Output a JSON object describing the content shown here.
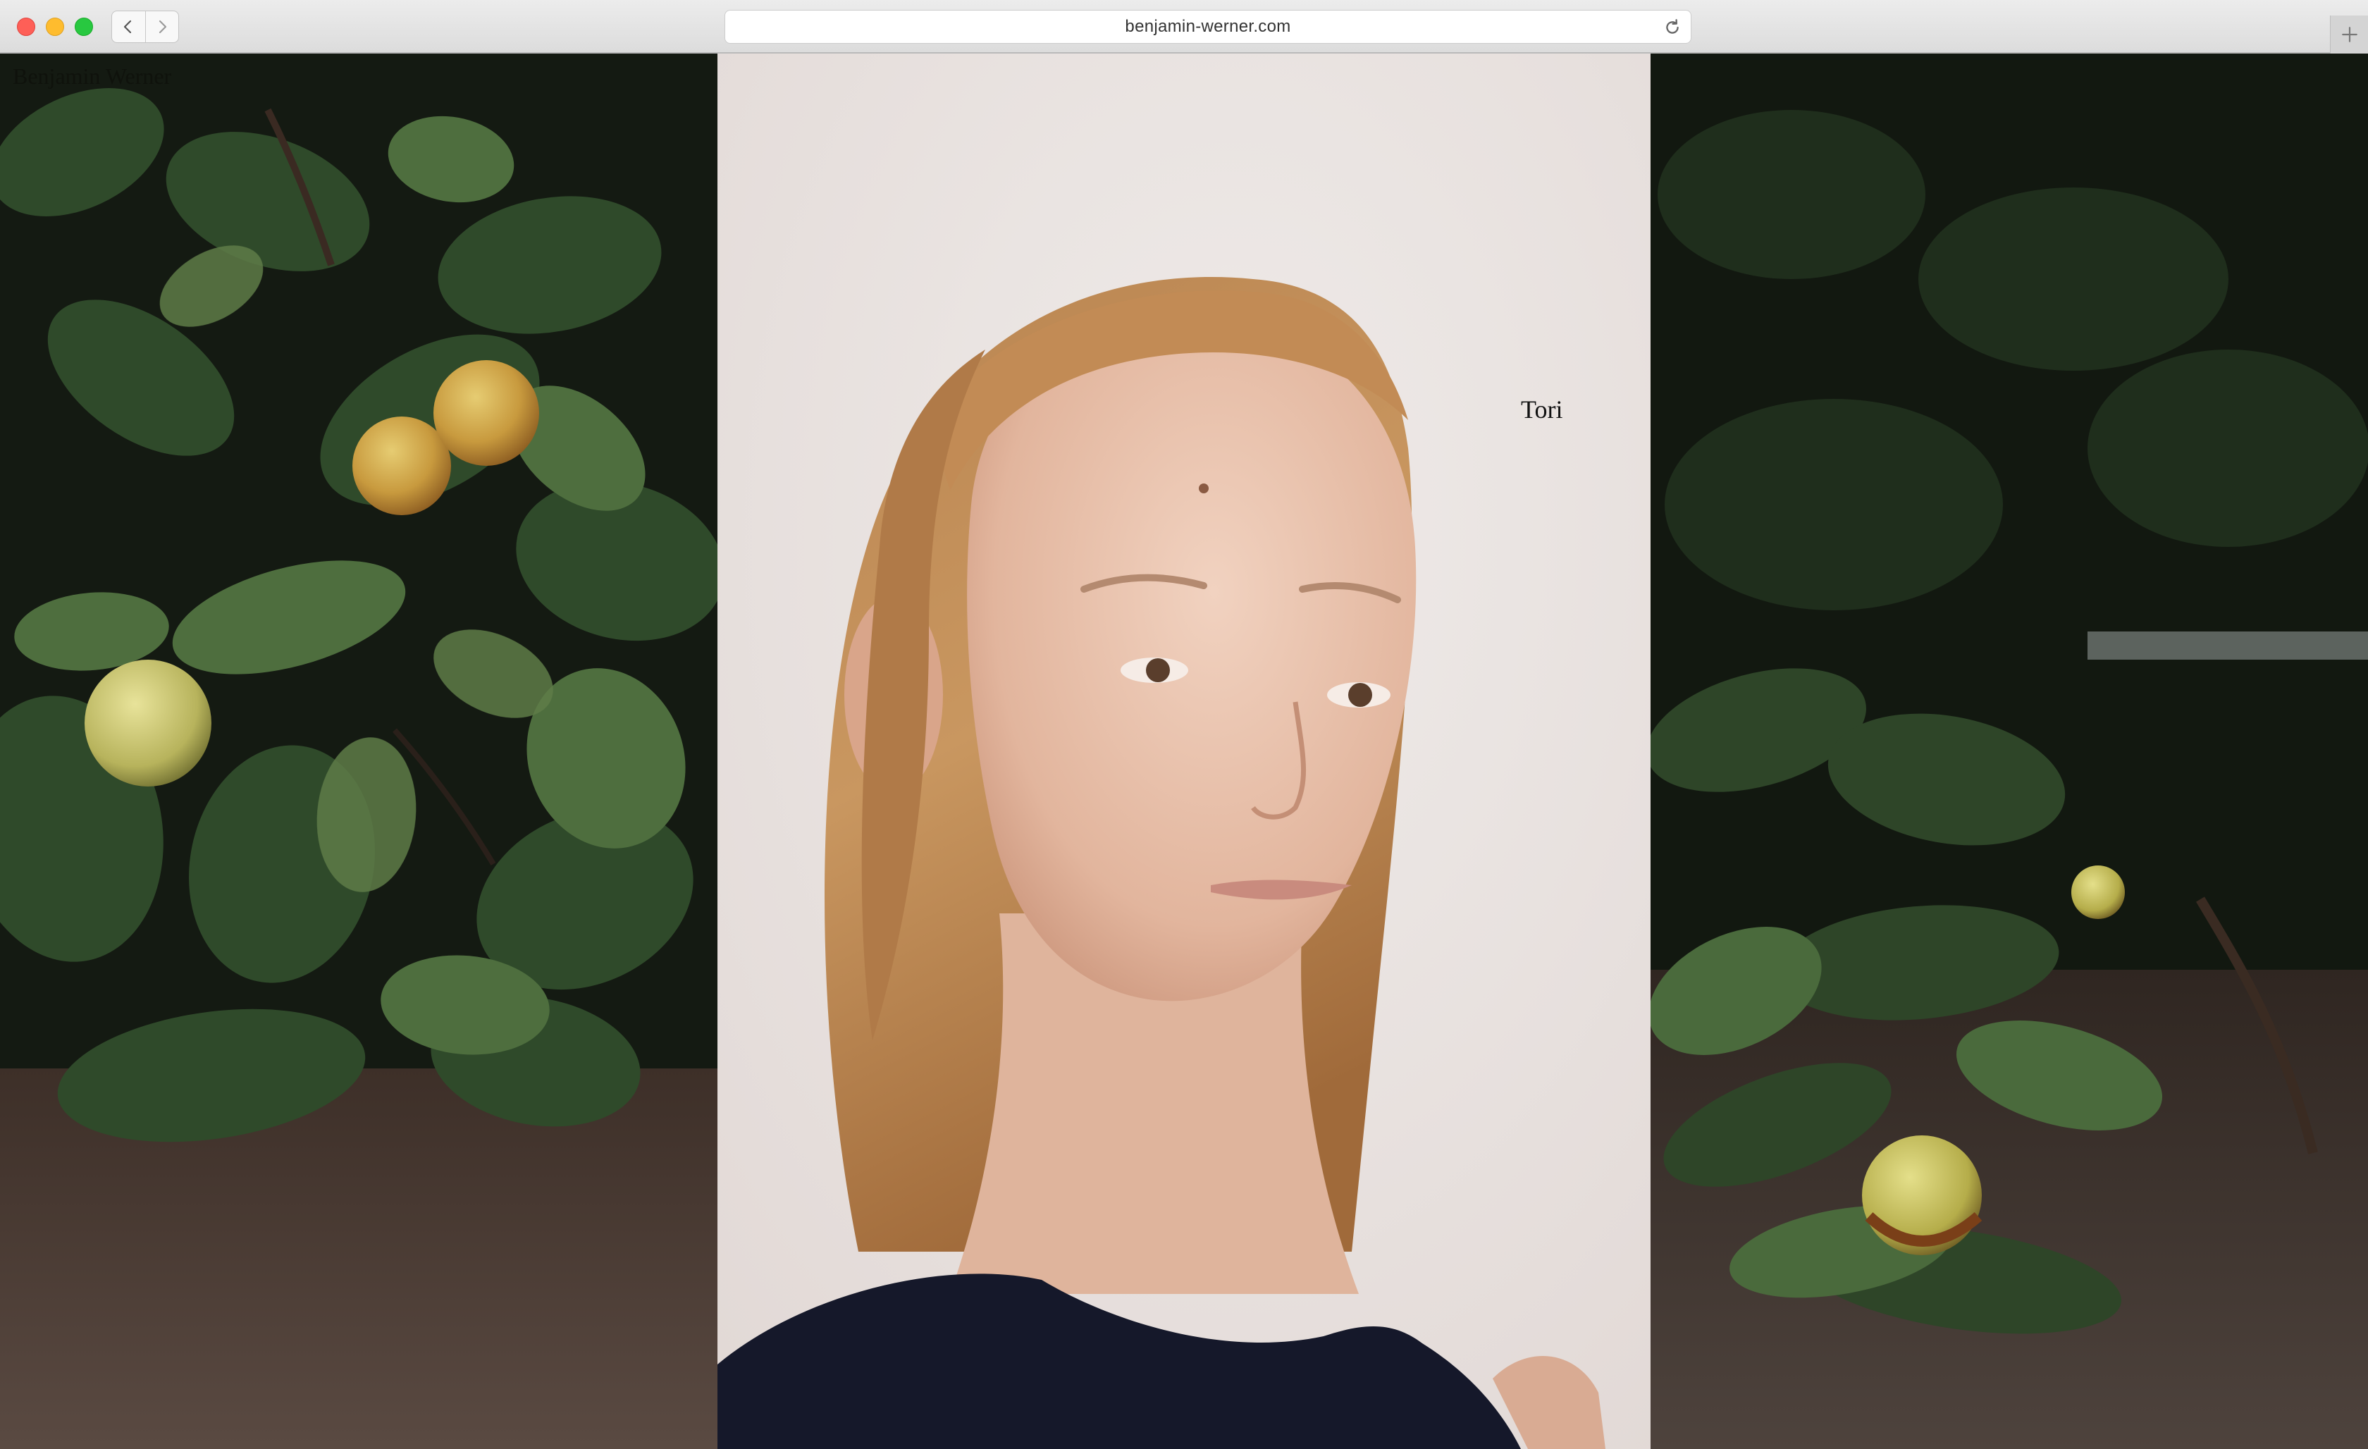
{
  "browser": {
    "url": "benjamin-werner.com",
    "icons": {
      "back": "chevron-left-icon",
      "forward": "chevron-right-icon",
      "reload": "reload-icon",
      "new_tab": "plus-icon"
    }
  },
  "site": {
    "title": "Benjamin Werner"
  },
  "gallery": {
    "caption": "Tori",
    "images": [
      {
        "subject": "apple-tree-foliage"
      },
      {
        "subject": "portrait"
      },
      {
        "subject": "fallen-apples-on-stone"
      }
    ]
  },
  "colors": {
    "portrait_background": "#ebe5e3",
    "foliage_dark": "#1b2418",
    "leaf_green": "#3f5a33",
    "stone": "#4a3c34"
  }
}
